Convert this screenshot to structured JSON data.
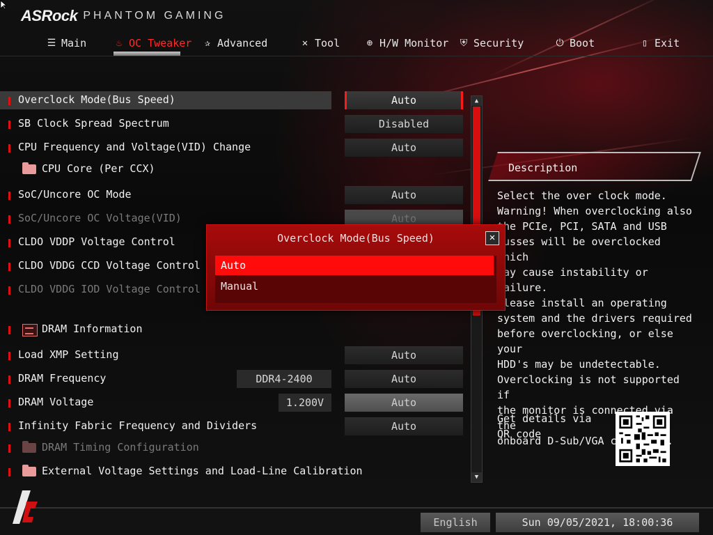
{
  "header": {
    "brand": "ASRock",
    "subtitle": "PHANTOM GAMING"
  },
  "nav": [
    {
      "label": "Main",
      "icon": "list-icon"
    },
    {
      "label": "OC Tweaker",
      "icon": "flame-icon"
    },
    {
      "label": "Advanced",
      "icon": "star-icon"
    },
    {
      "label": "Tool",
      "icon": "tools-icon"
    },
    {
      "label": "H/W Monitor",
      "icon": "crosshair-icon"
    },
    {
      "label": "Security",
      "icon": "shield-icon"
    },
    {
      "label": "Boot",
      "icon": "power-icon"
    },
    {
      "label": "Exit",
      "icon": "exit-door-icon"
    }
  ],
  "items": [
    {
      "label": "Overclock Mode(Bus Speed)",
      "value": "Auto"
    },
    {
      "label": "SB Clock Spread Spectrum",
      "value": "Disabled"
    },
    {
      "label": "CPU Frequency and Voltage(VID) Change",
      "value": "Auto"
    },
    {
      "label": "CPU Core (Per CCX)"
    },
    {
      "label": "SoC/Uncore OC Mode",
      "value": "Auto"
    },
    {
      "label": "SoC/Uncore OC Voltage(VID)",
      "value": "Auto"
    },
    {
      "label": "CLDO VDDP Voltage Control"
    },
    {
      "label": "CLDO VDDG CCD Voltage Control"
    },
    {
      "label": "CLDO VDDG IOD Voltage Control"
    },
    {
      "label": "DRAM Information"
    },
    {
      "label": "Load XMP Setting",
      "value": "Auto"
    },
    {
      "label": "DRAM Frequency",
      "current": "DDR4-2400",
      "value": "Auto"
    },
    {
      "label": "DRAM Voltage",
      "current": "1.200V",
      "value": "Auto"
    },
    {
      "label": "Infinity Fabric Frequency and Dividers",
      "value": "Auto"
    },
    {
      "label": "DRAM Timing Configuration"
    },
    {
      "label": "External Voltage Settings and Load-Line Calibration"
    }
  ],
  "description": {
    "title": "Description",
    "text": "Select the over clock mode.\nWarning! When overclocking also\nthe PCIe, PCI, SATA and USB\nbusses will be overclocked which\nmay cause instability or failure.\nPlease install an operating\nsystem and the drivers required\nbefore overclocking, or else your\nHDD's may be undetectable.\nOverclocking is not supported if\nthe monitor is connected via the\nonboard D-Sub/VGA connector.",
    "qr_label": "Get details via QR code"
  },
  "popup": {
    "title": "Overclock Mode(Bus Speed)",
    "options": [
      "Auto",
      "Manual"
    ],
    "selected": "Auto",
    "close_glyph": "✕"
  },
  "footer": {
    "language": "English",
    "datetime": "Sun 09/05/2021, 18:00:36"
  },
  "colors": {
    "accent": "#ff1a1a",
    "popup_bg": "#a80b0b"
  }
}
